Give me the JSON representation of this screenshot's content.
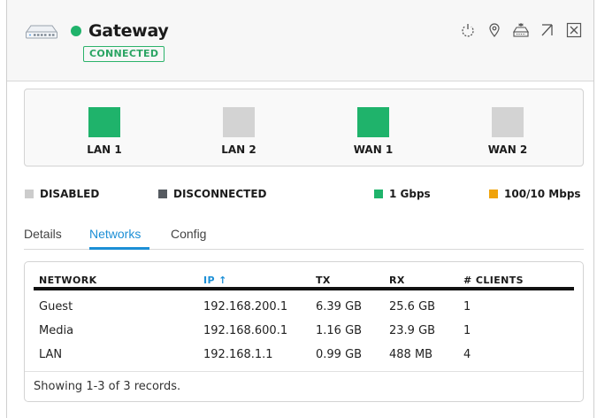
{
  "device": {
    "name": "Gateway",
    "status": "CONNECTED",
    "status_color": "#20b36b"
  },
  "header_actions": [
    {
      "name": "power-icon"
    },
    {
      "name": "location-pin-icon"
    },
    {
      "name": "locate-device-icon"
    },
    {
      "name": "popout-arrow-icon"
    },
    {
      "name": "close-icon"
    }
  ],
  "ports": [
    {
      "label": "LAN 1",
      "state": "1 Gbps",
      "color": "#1fb36b"
    },
    {
      "label": "LAN 2",
      "state": "DISABLED",
      "color": "#d3d3d3"
    },
    {
      "label": "WAN 1",
      "state": "1 Gbps",
      "color": "#1fb36b"
    },
    {
      "label": "WAN 2",
      "state": "DISABLED",
      "color": "#d3d3d3"
    }
  ],
  "legend": [
    {
      "label": "DISABLED",
      "color": "#cccccc"
    },
    {
      "label": "DISCONNECTED",
      "color": "#555a60"
    },
    {
      "label": "1 Gbps",
      "color": "#1fb36b"
    },
    {
      "label": "100/10 Mbps",
      "color": "#f0a30a"
    }
  ],
  "tabs": [
    {
      "label": "Details",
      "active": false
    },
    {
      "label": "Networks",
      "active": true
    },
    {
      "label": "Config",
      "active": false
    }
  ],
  "table": {
    "columns": [
      "NETWORK",
      "IP ↑",
      "TX",
      "RX",
      "# CLIENTS"
    ],
    "sorted_column": "IP",
    "rows": [
      [
        "Guest",
        "192.168.200.1",
        "6.39 GB",
        "25.6 GB",
        "1"
      ],
      [
        "Media",
        "192.168.600.1",
        "1.16 GB",
        "23.9 GB",
        "1"
      ],
      [
        "LAN",
        "192.168.1.1",
        "0.99 GB",
        "488 MB",
        "4"
      ]
    ],
    "footer": "Showing 1-3 of 3 records."
  },
  "colors": {
    "accent": "#1c8fd6",
    "connected": "#20b36b"
  }
}
